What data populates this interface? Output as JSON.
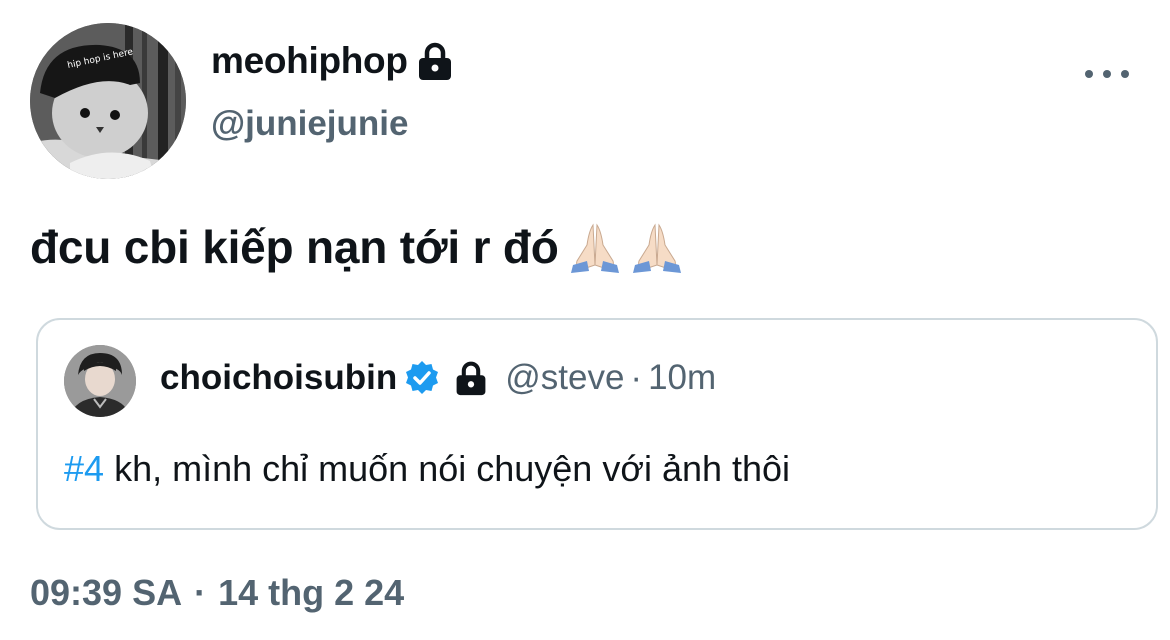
{
  "author": {
    "display_name": "meohiphop",
    "handle": "@juniejunie",
    "avatar_caption": "hip hop is here",
    "locked_icon": "lock-icon"
  },
  "tweet": {
    "text": "đcu cbi kiếp nạn tới r đó",
    "emoji": [
      "🙏🏻",
      "🙏🏻"
    ]
  },
  "quoted_tweet": {
    "display_name": "choichoisubin",
    "handle": "@steve",
    "separator": "·",
    "time": "10m",
    "hashtag": "#4",
    "text": "kh, mình chỉ muốn nói chuyện với ảnh thôi"
  },
  "timestamp": {
    "time": "09:39 SA",
    "separator": "·",
    "date": "14 thg 2 24"
  },
  "colors": {
    "secondary": "#536471",
    "link": "#1d9bf0",
    "border": "#cfd9de",
    "verified": "#1d9bf0"
  }
}
